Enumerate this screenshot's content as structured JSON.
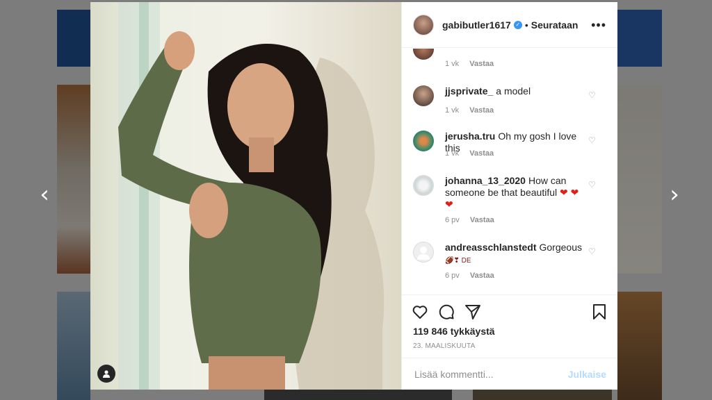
{
  "colors": {
    "accent": "#3897f0",
    "publish_disabled": "#b3dbff",
    "heart_red": "#e0211b"
  },
  "navigation": {
    "prev_icon": "chevron-left-icon",
    "next_icon": "chevron-right-icon"
  },
  "post": {
    "author": "gabibutler1617",
    "verified": true,
    "separator": "•",
    "follow_status": "Seurataan",
    "more_icon": "more-options-icon"
  },
  "comments": [
    {
      "user": "",
      "text": "",
      "time": "1 vk",
      "reply": "Vastaa"
    },
    {
      "user": "jjsprivate_",
      "text": "a model",
      "time": "1 vk",
      "reply": "Vastaa"
    },
    {
      "user": "jerusha.tru",
      "text": "Oh my gosh I love this",
      "time": "1 vk",
      "reply": "Vastaa"
    },
    {
      "user": "johanna_13_2020",
      "text": "How can someone be that beautiful",
      "emoji": "❤ ❤ ❤",
      "time": "6 pv",
      "reply": "Vastaa"
    },
    {
      "user": "andreasschlanstedt",
      "text": "Gorgeous",
      "emoji": "🏈❣ DE",
      "time": "6 pv",
      "reply": "Vastaa"
    }
  ],
  "actions": {
    "like_icon": "heart-icon",
    "comment_icon": "comment-icon",
    "share_icon": "share-icon",
    "save_icon": "bookmark-icon",
    "likes": "119 846 tykkäystä",
    "date": "23. MAALISKUUTA"
  },
  "add_comment": {
    "placeholder": "Lisää kommentti...",
    "publish_label": "Julkaise"
  }
}
